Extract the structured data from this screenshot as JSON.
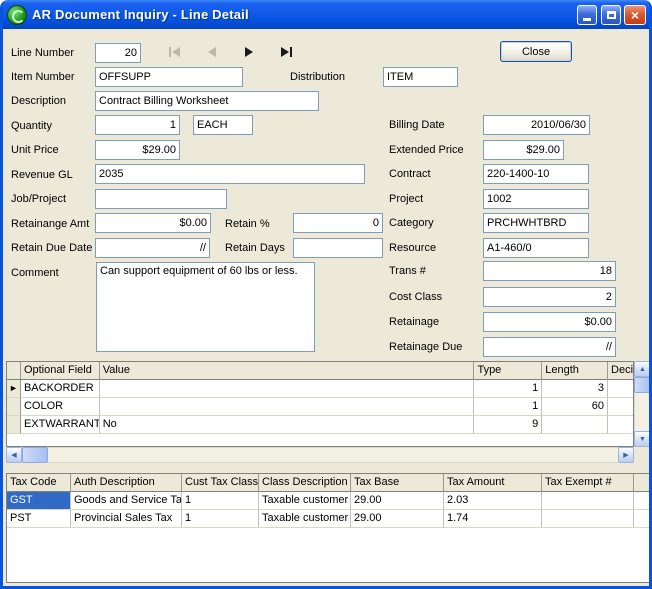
{
  "window": {
    "title": "AR Document Inquiry - Line Detail"
  },
  "colors": {
    "titlebar": "#0C59D8",
    "dialog_bg": "#ECE9D8",
    "selection": "#316AC5",
    "field_border": "#7F9DB9"
  },
  "buttons": {
    "close_label": "Close"
  },
  "fields": {
    "line_number": {
      "label": "Line Number",
      "value": "20"
    },
    "item_number": {
      "label": "Item Number",
      "value": "OFFSUPP"
    },
    "distribution": {
      "label": "Distribution",
      "value": "ITEM"
    },
    "description": {
      "label": "Description",
      "value": "Contract Billing Worksheet"
    },
    "quantity": {
      "label": "Quantity",
      "value": "1"
    },
    "uom": {
      "value": "EACH"
    },
    "unit_price": {
      "label": "Unit Price",
      "value": "$29.00"
    },
    "revenue_gl": {
      "label": "Revenue GL",
      "value": "2035"
    },
    "job_project": {
      "label": "Job/Project",
      "value": ""
    },
    "retainange_amt": {
      "label": "Retainange Amt",
      "value": "$0.00"
    },
    "retain_pct": {
      "label": "Retain %",
      "value": "0"
    },
    "retain_due_date": {
      "label": "Retain Due Date",
      "value": "//"
    },
    "retain_days": {
      "label": "Retain Days",
      "value": ""
    },
    "comment": {
      "label": "Comment",
      "value": "Can support equipment of 60 lbs or less."
    },
    "billing_date": {
      "label": "Billing Date",
      "value": "2010/06/30"
    },
    "extended_price": {
      "label": "Extended Price",
      "value": "$29.00"
    },
    "contract": {
      "label": "Contract",
      "value": "220-1400-10"
    },
    "project": {
      "label": "Project",
      "value": "1002"
    },
    "category": {
      "label": "Category",
      "value": "PRCHWHTBRD"
    },
    "resource": {
      "label": "Resource",
      "value": "A1-460/0"
    },
    "trans_num": {
      "label": "Trans #",
      "value": "18"
    },
    "cost_class": {
      "label": "Cost Class",
      "value": "2"
    },
    "retainage": {
      "label": "Retainage",
      "value": "$0.00"
    },
    "retainage_due": {
      "label": "Retainage Due",
      "value": "//"
    }
  },
  "optional_grid": {
    "headers": [
      "Optional Field",
      "Value",
      "Type",
      "Length",
      "Deci"
    ],
    "rows": [
      {
        "field": "BACKORDER",
        "value": "",
        "type": "1",
        "length": "3",
        "deci": ""
      },
      {
        "field": "COLOR",
        "value": "",
        "type": "1",
        "length": "60",
        "deci": ""
      },
      {
        "field": "EXTWARRANTY",
        "value": "No",
        "type": "9",
        "length": "",
        "deci": ""
      }
    ]
  },
  "tax_grid": {
    "headers": [
      "Tax Code",
      "Auth Description",
      "Cust Tax Class",
      "Class Description",
      "Tax Base",
      "Tax Amount",
      "Tax Exempt #"
    ],
    "rows": [
      {
        "tax_code": "GST",
        "auth_description": "Goods and Service Tax",
        "cust_tax_class": "1",
        "class_description": "Taxable customer",
        "tax_base": "29.00",
        "tax_amount": "2.03",
        "tax_exempt": ""
      },
      {
        "tax_code": "PST",
        "auth_description": "Provincial Sales Tax",
        "cust_tax_class": "1",
        "class_description": "Taxable customer",
        "tax_base": "29.00",
        "tax_amount": "1.74",
        "tax_exempt": ""
      }
    ]
  }
}
